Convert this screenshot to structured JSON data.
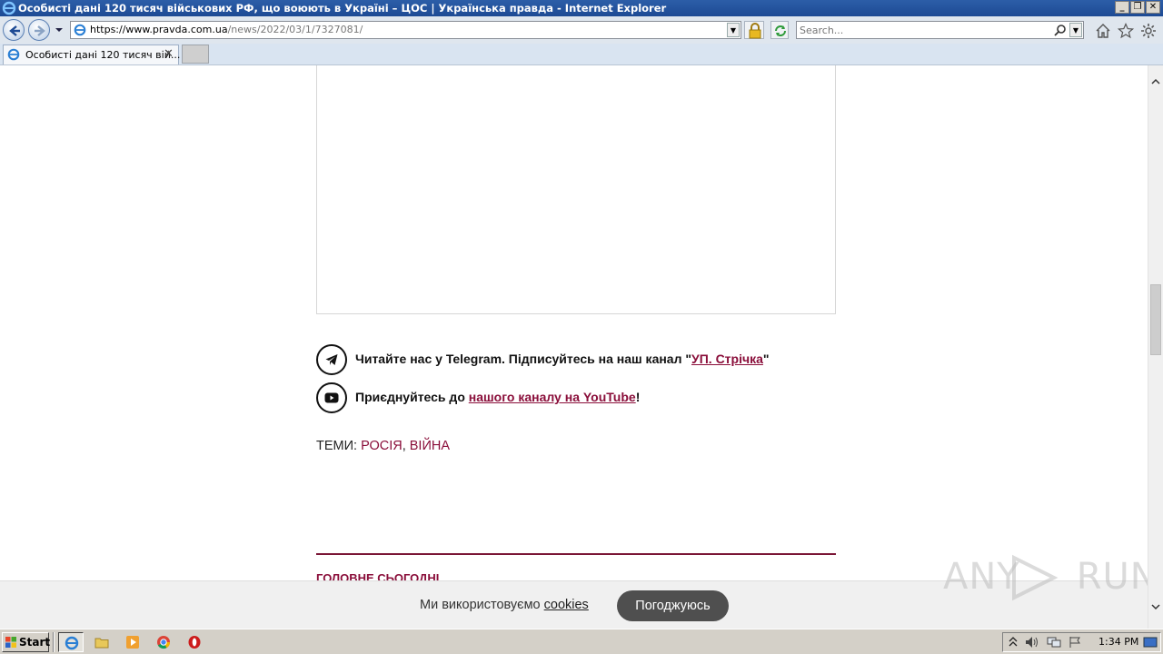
{
  "window": {
    "title": "Особисті дані 120 тисяч військових РФ, що воюють в Україні – ЦОС | Українська правда - Internet Explorer",
    "controls": [
      "minimize",
      "restore",
      "close"
    ]
  },
  "address_bar": {
    "url_host": "https://www.pravda.com.ua",
    "url_path": "/news/2022/03/1/7327081/"
  },
  "search": {
    "placeholder": "Search..."
  },
  "tabs": [
    {
      "title": "Особисті дані 120 тисяч вій...",
      "close": "✕"
    }
  ],
  "article": {
    "telegram": {
      "text_before": "Читайте нас у Telegram. Підписуйтесь на наш канал \"",
      "link_text": "УП. Стрічка",
      "text_after": "\""
    },
    "youtube": {
      "text_before": "Приєднуйтесь до ",
      "link_text": "нашого каналу на YouTube",
      "text_after": "!"
    },
    "topics_label": "ТЕМИ:",
    "topics": [
      "РОСІЯ",
      "ВІЙНА"
    ],
    "topics_separator": ", ",
    "section_heading": "ГОЛОВНЕ СЬОГОДНІ"
  },
  "cookie_banner": {
    "text": "Ми використовуємо ",
    "link_text": "cookies",
    "accept_label": "Погоджуюсь"
  },
  "watermark": {
    "left": "ANY",
    "right": "RUN"
  },
  "taskbar": {
    "start_label": "Start",
    "apps": [
      "internet-explorer",
      "file-explorer",
      "media-player",
      "chrome",
      "opera"
    ],
    "clock": "1:34 PM"
  },
  "colors": {
    "maroon": "#8a0e3a",
    "divider": "#7a1535",
    "title_bar": "#1d4a94",
    "accept_button": "#4f4f4f"
  }
}
